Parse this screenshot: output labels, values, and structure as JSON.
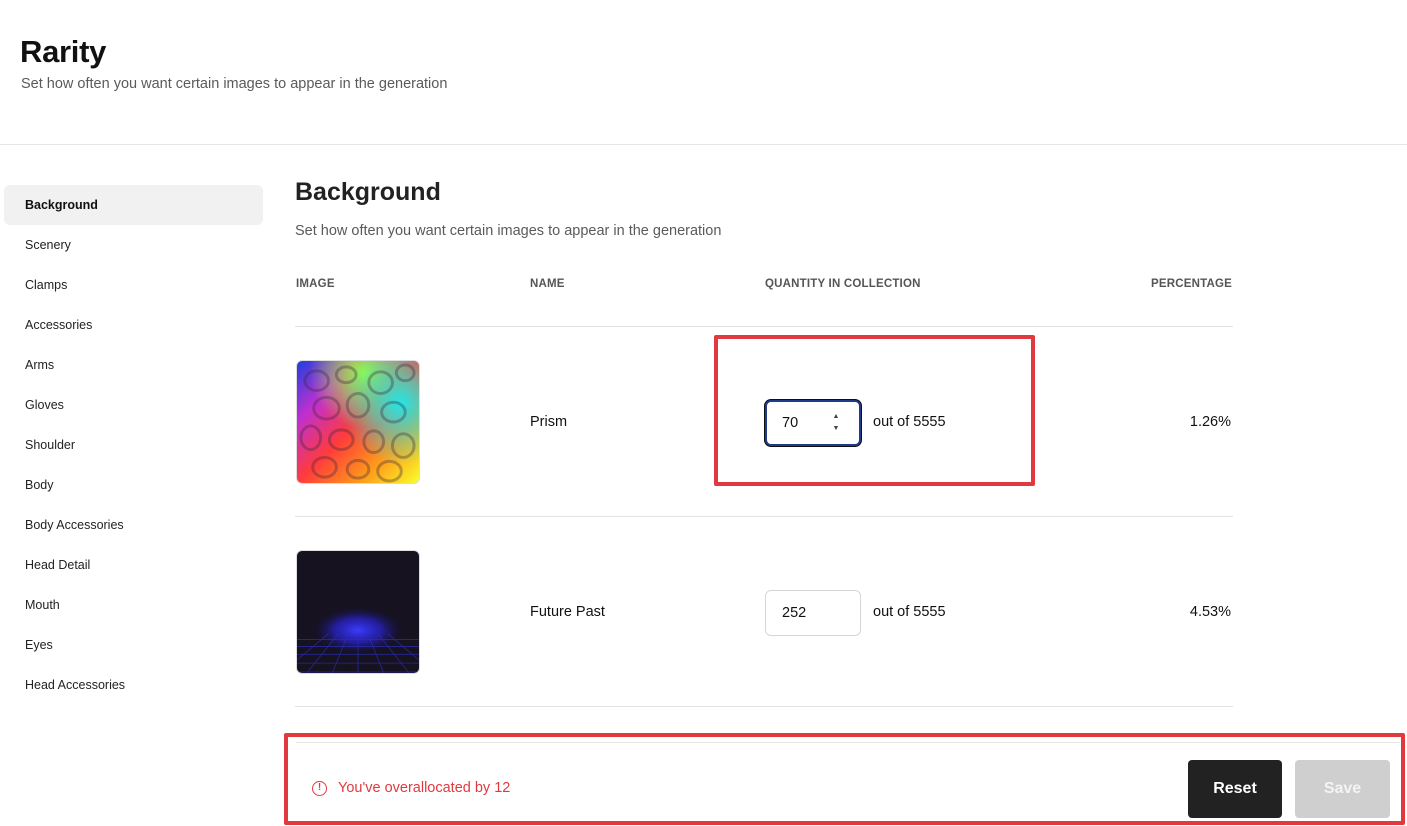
{
  "header": {
    "title": "Rarity",
    "subtitle": "Set how often you want certain images to appear in the generation"
  },
  "sidebar": {
    "items": [
      {
        "label": "Background",
        "active": true
      },
      {
        "label": "Scenery"
      },
      {
        "label": "Clamps"
      },
      {
        "label": "Accessories"
      },
      {
        "label": "Arms"
      },
      {
        "label": "Gloves"
      },
      {
        "label": "Shoulder"
      },
      {
        "label": "Body"
      },
      {
        "label": "Body Accessories"
      },
      {
        "label": "Head Detail"
      },
      {
        "label": "Mouth"
      },
      {
        "label": "Eyes"
      },
      {
        "label": "Head Accessories"
      }
    ]
  },
  "section": {
    "title": "Background",
    "subtitle": "Set how often you want certain images to appear in the generation"
  },
  "table": {
    "columns": [
      "IMAGE",
      "NAME",
      "QUANTITY IN COLLECTION",
      "PERCENTAGE"
    ],
    "rows": [
      {
        "name": "Prism",
        "quantity": "70",
        "out_of": "out of 5555",
        "percentage": "1.26%",
        "image_icon": "prism-thumbnail"
      },
      {
        "name": "Future Past",
        "quantity": "252",
        "out_of": "out of 5555",
        "percentage": "4.53%",
        "image_icon": "future-past-thumbnail"
      }
    ]
  },
  "footer": {
    "alert_text": "You've overallocated by 12",
    "alert_icon": "alert-circle-icon",
    "reset_label": "Reset",
    "save_label": "Save"
  },
  "colors": {
    "accent_red": "#e03a3f",
    "button_dark": "#222222",
    "button_disabled": "#cfcfcf",
    "focus_blue": "#1e3a8a"
  }
}
